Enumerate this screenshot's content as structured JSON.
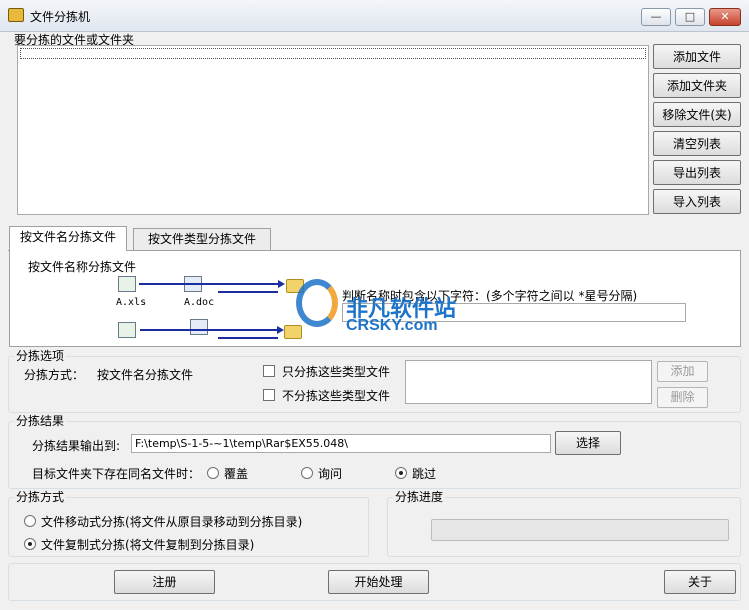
{
  "window": {
    "title": "文件分拣机",
    "min_glyph": "—",
    "max_glyph": "□",
    "close_glyph": "✕"
  },
  "files": {
    "group_label": "要分拣的文件或文件夹",
    "buttons": [
      "添加文件",
      "添加文件夹",
      "移除文件(夹)",
      "清空列表",
      "导出列表",
      "导入列表"
    ]
  },
  "tabs": [
    {
      "label": "按文件名分拣文件",
      "active": true
    },
    {
      "label": "按文件类型分拣文件",
      "active": false
    }
  ],
  "tab_panel": {
    "heading": "按文件名称分拣文件",
    "file1": "A.xls",
    "file2": "A.doc",
    "instruction": "判断名称时包含以下字符：(多个字符之间以 *星号分隔)"
  },
  "options": {
    "group_label": "分拣选项",
    "method_label": "分拣方式：",
    "method_value": "按文件名分拣文件",
    "only_types_label": "只分拣这些类型文件",
    "except_types_label": "不分拣这些类型文件",
    "add_label": "添加",
    "delete_label": "删除"
  },
  "result": {
    "group_label": "分拣结果",
    "output_label": "分拣结果输出到:",
    "output_path": "F:\\temp\\S-1-5-~1\\temp\\Rar$EX55.048\\",
    "choose_label": "选择",
    "exists_label": "目标文件夹下存在同名文件时：",
    "radios": [
      {
        "label": "覆盖",
        "checked": false
      },
      {
        "label": "询问",
        "checked": false
      },
      {
        "label": "跳过",
        "checked": true
      }
    ]
  },
  "mode": {
    "group_label": "分拣方式",
    "move_label": "文件移动式分拣(将文件从原目录移动到分拣目录)",
    "move_checked": false,
    "copy_label": "文件复制式分拣(将文件复制到分拣目录)",
    "copy_checked": true
  },
  "progress": {
    "group_label": "分拣进度",
    "value": 0
  },
  "footer": {
    "register_label": "注册",
    "start_label": "开始处理",
    "about_label": "关于"
  },
  "watermark": {
    "line1": "非凡软件站",
    "line2": "CRSKY.com"
  },
  "colors": {
    "arrow": "#1a2ea0",
    "watermark_blue": "#1e74c8",
    "watermark_orange": "#f29a1e"
  }
}
